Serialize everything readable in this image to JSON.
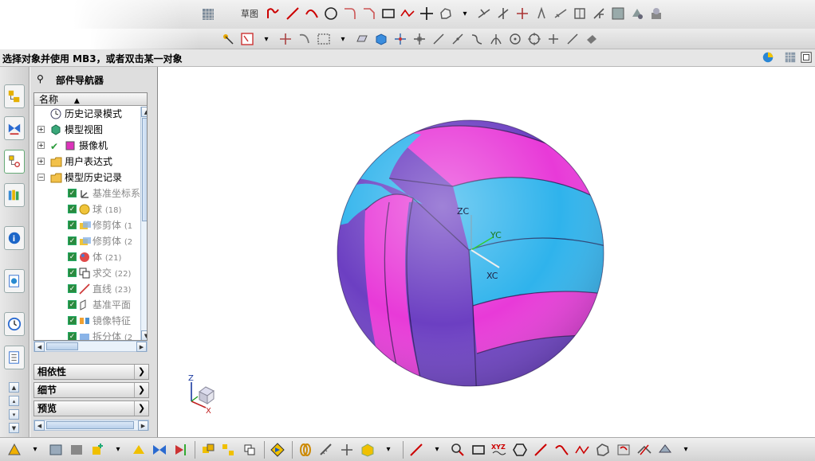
{
  "toolbar": {
    "sketch_label": "草图"
  },
  "status": {
    "prompt": "选择对象并使用 MB3，或者双击某一对象"
  },
  "navigator": {
    "title": "部件导航器",
    "column_header": "名称",
    "items": [
      {
        "label": "历史记录模式",
        "expandable": false
      },
      {
        "label": "模型视图",
        "expandable": true
      },
      {
        "label": "摄像机",
        "expandable": true
      },
      {
        "label": "用户表达式",
        "expandable": true
      },
      {
        "label": "模型历史记录",
        "expandable": true
      }
    ],
    "history": [
      {
        "label": "基准坐标系",
        "num": ""
      },
      {
        "label": "球",
        "num": "(18)"
      },
      {
        "label": "修剪体",
        "num": "(1"
      },
      {
        "label": "修剪体",
        "num": "(2"
      },
      {
        "label": "体",
        "num": "(21)"
      },
      {
        "label": "求交",
        "num": "(22)"
      },
      {
        "label": "直线",
        "num": "(23)"
      },
      {
        "label": "基准平面",
        "num": ""
      },
      {
        "label": "镜像特征",
        "num": ""
      },
      {
        "label": "拆分体",
        "num": "(2"
      }
    ],
    "sections": [
      "相依性",
      "细节",
      "预览"
    ]
  },
  "viewport": {
    "axis_labels": {
      "zc": "ZC",
      "yc": "YC",
      "xc": "XC"
    },
    "triad_labels": {
      "z": "Z",
      "x": "X"
    },
    "colors": {
      "magenta": "#e83ad8",
      "cyan": "#2fb3ec",
      "violet": "#6c3fc2",
      "dark_violet": "#4e2aa0"
    }
  }
}
